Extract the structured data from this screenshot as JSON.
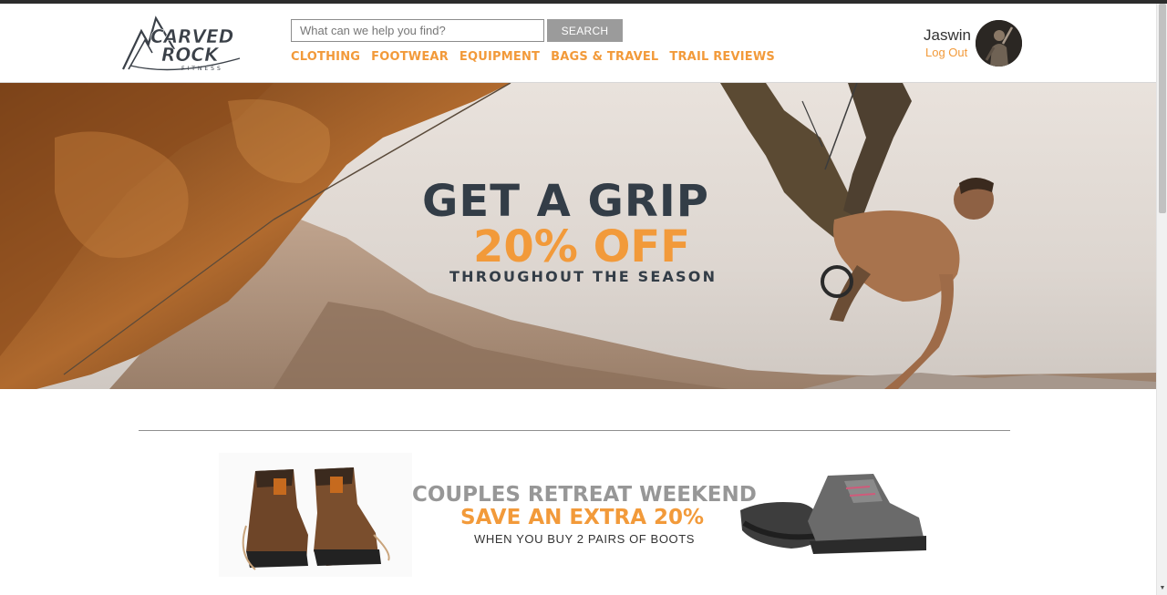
{
  "brand": {
    "name_line1": "CARVED",
    "name_line2": "ROCK",
    "tagline": "FITNESS"
  },
  "search": {
    "placeholder": "What can we help you find?",
    "value": "",
    "button_label": "SEARCH"
  },
  "nav": {
    "items": [
      {
        "label": "CLOTHING"
      },
      {
        "label": "FOOTWEAR"
      },
      {
        "label": "EQUIPMENT"
      },
      {
        "label": "BAGS & TRAVEL"
      },
      {
        "label": "TRAIL REVIEWS"
      }
    ]
  },
  "user": {
    "name": "Jaswin",
    "logout_label": "Log Out"
  },
  "hero": {
    "title": "GET A GRIP",
    "offer": "20% OFF",
    "subtitle": "THROUGHOUT THE SEASON"
  },
  "promo": {
    "title": "COUPLES RETREAT WEEKEND",
    "offer": "SAVE AN EXTRA 20%",
    "subtitle": "WHEN YOU BUY 2 PAIRS OF BOOTS"
  },
  "colors": {
    "accent": "#f29a3a",
    "heading_dark": "#333d47",
    "promo_grey": "#979797",
    "button_grey": "#9b9b9b"
  },
  "icons": {
    "logo": "mountain-logo-icon",
    "avatar": "climber-avatar"
  }
}
